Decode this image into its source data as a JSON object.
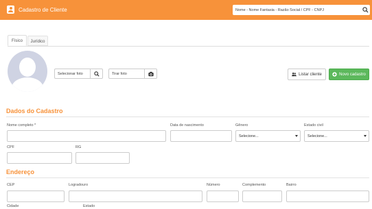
{
  "header": {
    "title": "Cadastro de Cliente",
    "search_placeholder": "Nome - Nome Fantasia - Razão Social / CPF - CNPJ",
    "accent_color": "#f7923a"
  },
  "tabs": [
    {
      "label": "Físico",
      "active": true
    },
    {
      "label": "Jurídico",
      "active": false
    }
  ],
  "photo": {
    "select_placeholder": "Selecionar foto",
    "select_icon": "search-icon",
    "take_placeholder": "Tirar foto",
    "take_icon": "camera-icon"
  },
  "actions": {
    "listar_label": "Listar cliente",
    "listar_icon": "users-icon",
    "novo_label": "Novo cadastro",
    "novo_icon": "plus-circle-icon",
    "novo_color": "#5cb85c"
  },
  "dados": {
    "title": "Dados do Cadastro",
    "nome_label": "Nome completo *",
    "nascimento_label": "Data de nascimento",
    "genero_label": "Gênero",
    "genero_value": "Selecione...",
    "estado_civil_label": "Estado civil",
    "estado_civil_value": "Selecione...",
    "cpf_label": "CPF",
    "rg_label": "RG"
  },
  "endereco": {
    "title": "Endereço",
    "cep_label": "CEP",
    "logradouro_label": "Logradouro",
    "numero_label": "Número",
    "complemento_label": "Complemento",
    "bairro_label": "Bairro",
    "cidade_label": "Cidade",
    "estado_label": "Estado"
  }
}
